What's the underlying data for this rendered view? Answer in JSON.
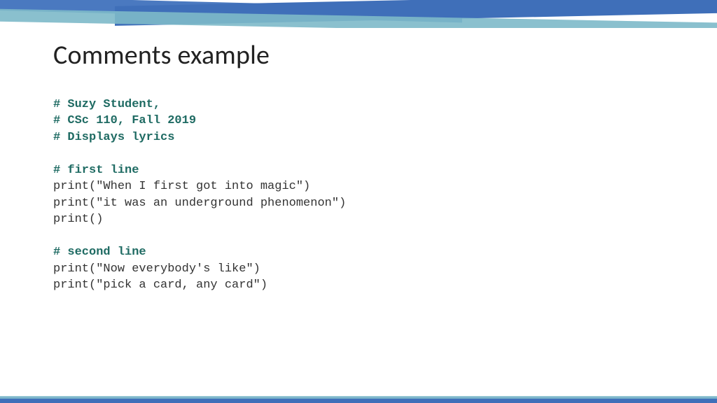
{
  "title": "Comments example",
  "code": {
    "c1": "# Suzy Student,",
    "c2": "# CSc 110, Fall 2019",
    "c3": "# Displays lyrics",
    "blank1": "",
    "c4": "# first line",
    "l1": "print(\"When I first got into magic\")",
    "l2": "print(\"it was an underground phenomenon\")",
    "l3": "print()",
    "blank2": "",
    "c5": "# second line",
    "l4": "print(\"Now everybody's like\")",
    "l5": "print(\"pick a card, any card\")"
  }
}
